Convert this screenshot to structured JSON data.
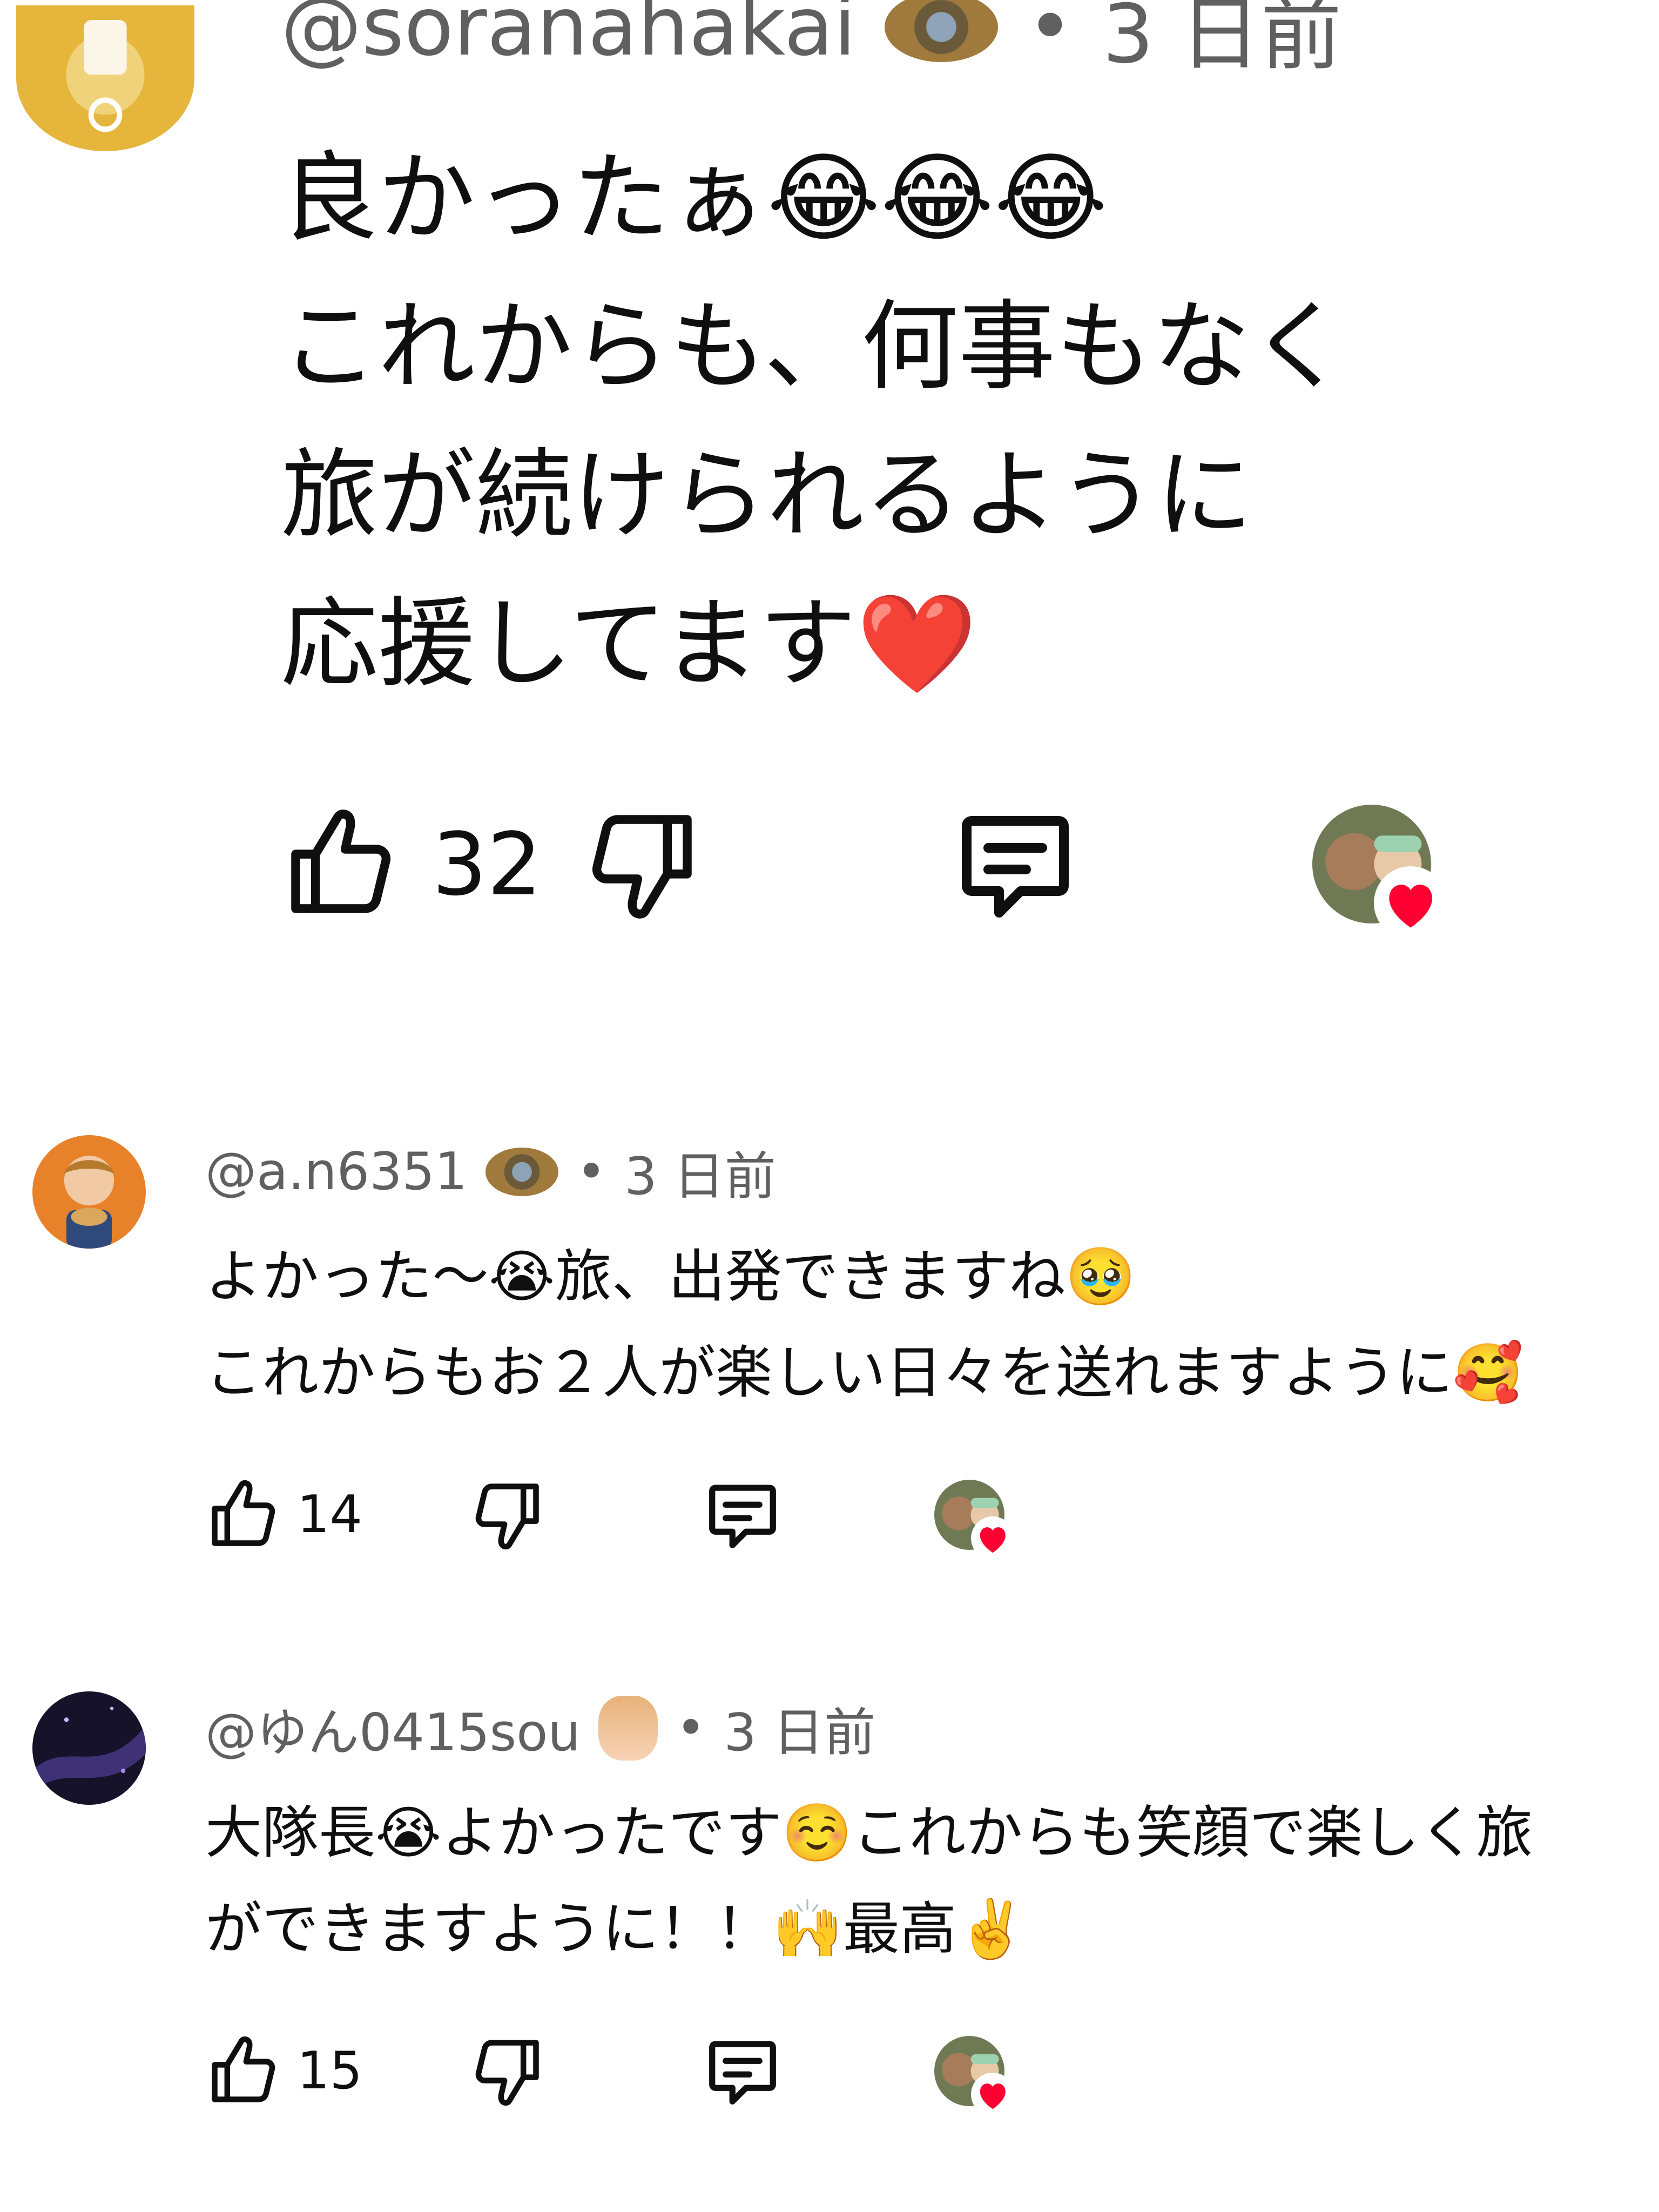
{
  "comments": [
    {
      "author": "@soranahakai",
      "time": "3 日前",
      "text": "良かったぁ😂😂😂\nこれからも、何事もなく\n旅が続けられるように\n応援してます❤️",
      "likes": "32",
      "avatar_icon": "dog-photo-avatar",
      "badge_icon": "member-badge-icon",
      "creator_hearted": true
    },
    {
      "author": "@a.n6351",
      "time": "3 日前",
      "text": "よかった〜😭旅、出発できますね🥹\nこれからもお２人が楽しい日々を送れますように🥰",
      "likes": "14",
      "avatar_icon": "person-photo-avatar",
      "badge_icon": "member-badge-icon",
      "creator_hearted": true
    },
    {
      "author": "@ゆん0415sou",
      "time": "3 日前",
      "text": "大隊長😭よかったです☺️これからも笑顔で楽しく旅\nができますように！！🙌最高✌️",
      "likes": "15",
      "avatar_icon": "night-sky-avatar",
      "badge_icon": "emoji-badge-icon",
      "creator_hearted": true
    }
  ],
  "separator": "•",
  "colors": {
    "text": "#0f0f0f",
    "meta": "#606060",
    "heart": "#ff0033",
    "background": "#ffffff"
  }
}
